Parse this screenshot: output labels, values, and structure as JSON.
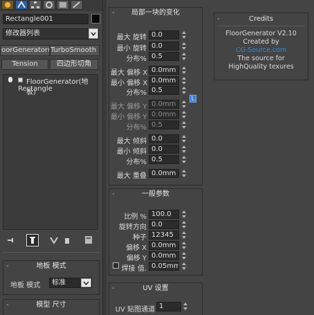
{
  "left_panel": {
    "object_name": "Rectangle001",
    "modifier_list_label": "修改器列表",
    "modifier_buttons": [
      "oorGenerator(地板",
      "TurboSmooth Pro",
      "Tension",
      "四边形切角"
    ],
    "stack_items": [
      "FloorGenerator(地板)",
      "Rectangle"
    ],
    "mode_rollout_title": "地板 模式",
    "mode_label": "地板 模式",
    "mode_value": "标准",
    "model_size_title": "模型 尺寸",
    "colors": {
      "accent": "#3a7bd5"
    }
  },
  "local_change": {
    "title": "局部一块的变化",
    "rows": [
      {
        "label": "最大 旋转",
        "value": "0.0",
        "dim": false
      },
      {
        "label": "最小 旋转",
        "value": "0.0",
        "dim": false
      },
      {
        "label": "分布%",
        "value": "0.5",
        "dim": false
      },
      {
        "label": "最大 偏移 X",
        "value": "0.0mm",
        "dim": false
      },
      {
        "label": "最小 偏移 X",
        "value": "0.0mm",
        "dim": false
      },
      {
        "label": "分布%",
        "value": "0.5",
        "dim": false
      },
      {
        "label": "最大 偏移 Y",
        "value": "0.0mm",
        "dim": true
      },
      {
        "label": "最小 偏移 Y",
        "value": "0.0mm",
        "dim": true
      },
      {
        "label": "分布%",
        "value": "0.5",
        "dim": true
      },
      {
        "label": "最大 倾斜",
        "value": "0.0",
        "dim": false
      },
      {
        "label": "最小 倾斜",
        "value": "0.0",
        "dim": false
      },
      {
        "label": "分布%",
        "value": "0.5",
        "dim": false
      },
      {
        "label": "最大 重叠",
        "value": "0.0mm",
        "dim": false
      }
    ],
    "lock_label": "L"
  },
  "general": {
    "title": "一般参数",
    "rows": [
      {
        "label": "比例 %",
        "value": "100.0",
        "spinner": true
      },
      {
        "label": "旋转方向",
        "value": "0.0",
        "spinner": true
      },
      {
        "label": "种子",
        "value": "12345",
        "spinner": true
      },
      {
        "label": "偏移 X",
        "value": "0.0mm",
        "spinner": true
      },
      {
        "label": "偏移 Y",
        "value": "0.0mm",
        "spinner": true
      },
      {
        "label": "焊接 值.",
        "value": "0.05mm",
        "spinner": true
      }
    ]
  },
  "uv": {
    "title": "UV 设置",
    "channel_label": "UV 贴图通道",
    "channel_value": "1"
  },
  "credits": {
    "title": "Credits",
    "lines": [
      "FloorGenerator V2.10",
      "Created by",
      "CG-Source.com",
      "The source for",
      "HighQuality texures"
    ],
    "link_color": "#2e8de0"
  }
}
